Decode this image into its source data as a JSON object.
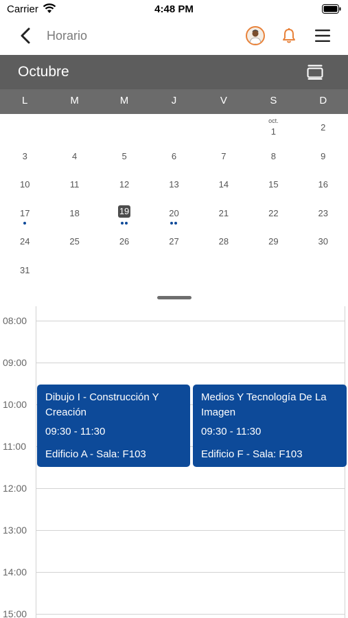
{
  "status_bar": {
    "carrier": "Carrier",
    "time": "4:48 PM"
  },
  "nav": {
    "title": "Horario",
    "icons": [
      "back-chevron",
      "avatar",
      "bell",
      "menu"
    ],
    "accent_color": "#e8823a"
  },
  "calendar": {
    "month": "Octubre",
    "weekdays": [
      "L",
      "M",
      "M",
      "J",
      "V",
      "S",
      "D"
    ],
    "first_day_label": "oct.",
    "selected_day": "19",
    "weeks": [
      [
        "",
        "",
        "",
        "",
        "",
        "1",
        "2"
      ],
      [
        "3",
        "4",
        "5",
        "6",
        "7",
        "8",
        "9"
      ],
      [
        "10",
        "11",
        "12",
        "13",
        "14",
        "15",
        "16"
      ],
      [
        "17",
        "18",
        "19",
        "20",
        "21",
        "22",
        "23"
      ],
      [
        "24",
        "25",
        "26",
        "27",
        "28",
        "29",
        "30"
      ],
      [
        "31",
        "",
        "",
        "",
        "",
        "",
        ""
      ]
    ],
    "event_dots": {
      "17": 1,
      "19": 2,
      "20": 2
    },
    "header_color": "#5d5d5d",
    "dot_color": "#0d4a99"
  },
  "schedule": {
    "hours": [
      "08:00",
      "09:00",
      "10:00",
      "11:00",
      "12:00",
      "13:00",
      "14:00",
      "15:00"
    ],
    "events": [
      {
        "title": "Dibujo I - Construcción Y Creación",
        "time": "09:30 - 11:30",
        "room": "Edificio A - Sala: F103"
      },
      {
        "title": "Medios Y Tecnología De La Imagen",
        "time": "09:30 - 11:30",
        "room": "Edificio F - Sala: F103"
      }
    ],
    "event_color": "#0d4a99"
  }
}
